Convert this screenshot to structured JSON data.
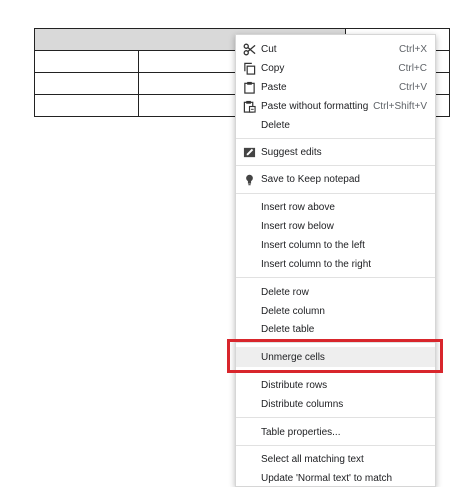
{
  "menu": {
    "cut": {
      "label": "Cut",
      "shortcut": "Ctrl+X",
      "icon": "scissors-icon"
    },
    "copy": {
      "label": "Copy",
      "shortcut": "Ctrl+C",
      "icon": "copy-icon"
    },
    "paste": {
      "label": "Paste",
      "shortcut": "Ctrl+V",
      "icon": "clipboard-icon"
    },
    "paste_plain": {
      "label": "Paste without formatting",
      "shortcut": "Ctrl+Shift+V",
      "icon": "clipboard-plain-icon"
    },
    "delete": {
      "label": "Delete"
    },
    "suggest": {
      "label": "Suggest edits",
      "icon": "suggest-edit-icon"
    },
    "keep": {
      "label": "Save to Keep notepad",
      "icon": "lightbulb-icon"
    },
    "insert_row_above": {
      "label": "Insert row above"
    },
    "insert_row_below": {
      "label": "Insert row below"
    },
    "insert_col_left": {
      "label": "Insert column to the left"
    },
    "insert_col_right": {
      "label": "Insert column to the right"
    },
    "delete_row": {
      "label": "Delete row"
    },
    "delete_column": {
      "label": "Delete column"
    },
    "delete_table": {
      "label": "Delete table"
    },
    "unmerge": {
      "label": "Unmerge cells"
    },
    "distribute_rows": {
      "label": "Distribute rows"
    },
    "distribute_columns": {
      "label": "Distribute columns"
    },
    "table_properties": {
      "label": "Table properties..."
    },
    "select_matching": {
      "label": "Select all matching text"
    },
    "update_normal": {
      "label": "Update 'Normal text' to match"
    }
  },
  "colors": {
    "highlight_border": "#d8262c",
    "merged_cell": "#d9d9d9",
    "hover": "#eeeeee"
  }
}
